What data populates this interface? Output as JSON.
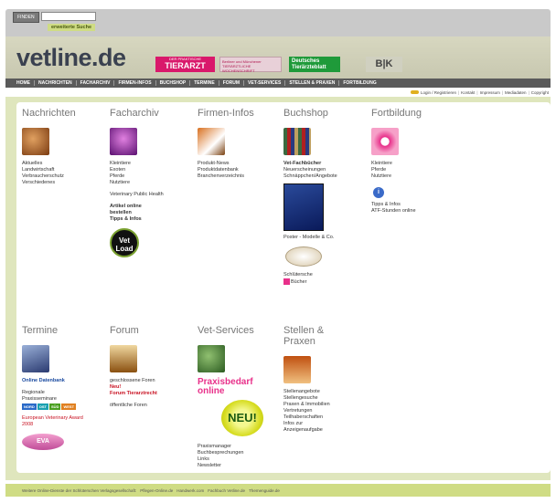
{
  "search": {
    "button_label": "FINDEN",
    "placeholder": "",
    "extended_label": "erweiterte Suche"
  },
  "header": {
    "logo": "vetline.de",
    "badges": {
      "tierarzt_small": "DER PRAKTISCHE",
      "tierarzt_big": "TIERARZT",
      "berliner": "Berliner und Münchener TIERÄRZTLICHE WOCHENSCHRIFT",
      "dtb": "Deutsches Tierärzteblatt",
      "bk": "B|K"
    }
  },
  "nav": [
    "HOME",
    "NACHRICHTEN",
    "FACHARCHIV",
    "FIRMEN-INFOS",
    "BUCHSHOP",
    "TERMINE",
    "FORUM",
    "VET-SERVICES",
    "STELLEN & PRAXEN",
    "FORTBILDUNG"
  ],
  "utility": [
    "Login / Registrieren",
    "Kontakt",
    "Impressum",
    "Mediadaten",
    "Copyright"
  ],
  "sections": {
    "nachrichten": {
      "title": "Nachrichten",
      "links": [
        "Aktuelles",
        "Landwirtschaft",
        "Verbraucherschutz",
        "Verschiedenes"
      ]
    },
    "facharchiv": {
      "title": "Facharchiv",
      "links": [
        "Kleintiere",
        "Exoten",
        "Pferde",
        "Nutztiere"
      ],
      "extra": "Veterinary Public Health",
      "bold_links": [
        "Artikel online bestellen",
        "Tipps & Infos"
      ],
      "vet_badge": "Vet Load"
    },
    "firmen": {
      "title": "Firmen-Infos",
      "links": [
        "Produkt-News",
        "Produktdatenbank",
        "Branchenverzeichnis"
      ]
    },
    "buchshop": {
      "title": "Buchshop",
      "bold_link": "Vet-Fachbücher",
      "links": [
        "Neuerscheinungen",
        "Schnäppchen/Angebote"
      ],
      "poster": "Poster - Modelle & Co.",
      "schluetersche": "Schlütersche",
      "buecher": "Bücher"
    },
    "fortbildung": {
      "title": "Fortbildung",
      "links": [
        "Kleintiere",
        "Pferde",
        "Nutztiere"
      ],
      "info_links": [
        "Tipps & Infos",
        "ATF-Stunden online"
      ],
      "info_icon": "i"
    },
    "termine": {
      "title": "Termine",
      "db_link": "Online Datenbank",
      "links": [
        "Regionale",
        "Praxisseminare"
      ],
      "regions": [
        "NORD",
        "OST",
        "SÜD",
        "WEST"
      ],
      "award": "European Veterinary Award 2008",
      "eva": "EVA"
    },
    "forum": {
      "title": "Forum",
      "links": [
        "geschlossene Foren"
      ],
      "red_links": [
        "Neu!",
        "Forum Tierarztrecht"
      ],
      "public": "öffentliche Foren"
    },
    "vetservices": {
      "title": "Vet-Services",
      "promo": "Praxisbedarf online",
      "neu": "NEU!",
      "links": [
        "Praxismanager",
        "Buchbesprechungen",
        "Links",
        "Newsletter"
      ]
    },
    "stellen": {
      "title": "Stellen & Praxen",
      "links": [
        "Stellenangebote",
        "Stellengesuche",
        "Praxen & Immobilien",
        "Vertretungen",
        "Teilhaberschaften",
        "Infos zur",
        "Anzeigenaufgabe"
      ]
    }
  },
  "footer": [
    "Weitere Online-Dienste der Schlüterschen Verlagsgesellschaft:",
    "Pflegen-Online.de",
    "Handwerk.com",
    "Fachbuch Vetline.de",
    "Themenguide.de"
  ]
}
